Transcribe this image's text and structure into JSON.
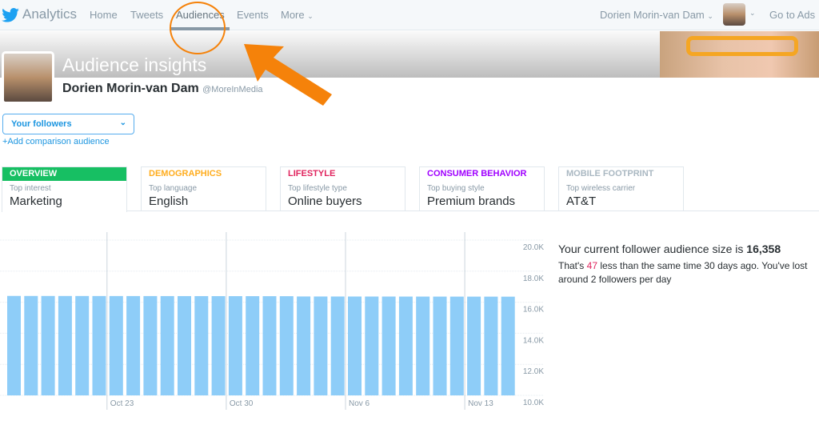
{
  "nav": {
    "brand": "Analytics",
    "items": [
      "Home",
      "Tweets",
      "Audiences",
      "Events",
      "More"
    ],
    "active": "Audiences",
    "user": "Dorien Morin-van Dam",
    "go_to_ads": "Go to Ads"
  },
  "header": {
    "title": "Audience insights",
    "name": "Dorien Morin-van Dam",
    "handle": "@MoreInMedia"
  },
  "audience_select": {
    "value": "Your followers",
    "add_link": "+Add comparison audience"
  },
  "tabs": [
    {
      "title": "OVERVIEW",
      "label": "Top interest",
      "value": "Marketing",
      "color": "#17bf63",
      "active": true
    },
    {
      "title": "DEMOGRAPHICS",
      "label": "Top language",
      "value": "English",
      "color": "#ffad1f"
    },
    {
      "title": "LIFESTYLE",
      "label": "Top lifestyle type",
      "value": "Online buyers",
      "color": "#e0245e"
    },
    {
      "title": "CONSUMER BEHAVIOR",
      "label": "Top buying style",
      "value": "Premium brands",
      "color": "#a000ff"
    },
    {
      "title": "MOBILE FOOTPRINT",
      "label": "Top wireless carrier",
      "value": "AT&T",
      "color": "#aab8c2"
    }
  ],
  "stats": {
    "headline": "Your current follower audience size is ",
    "size": "16,358",
    "pre": "That's ",
    "diff": "47",
    "post": " less than the same time 30 days ago. You've lost around 2 followers per day"
  },
  "chart_data": {
    "type": "bar",
    "ylim": [
      10000,
      20000
    ],
    "yticks": [
      "20.0K",
      "18.0K",
      "16.0K",
      "14.0K",
      "12.0K",
      "10.0K"
    ],
    "ytick_values": [
      20000,
      18000,
      16000,
      14000,
      12000,
      10000
    ],
    "xtick_labels": [
      "Oct 23",
      "Oct 30",
      "Nov 6",
      "Nov 13"
    ],
    "xtick_index": [
      6,
      13,
      20,
      27
    ],
    "bar_color": "#8ecdf8",
    "values": [
      16405,
      16403,
      16402,
      16401,
      16400,
      16399,
      16398,
      16397,
      16396,
      16395,
      16394,
      16393,
      16392,
      16391,
      16390,
      16389,
      16388,
      16370,
      16369,
      16368,
      16367,
      16366,
      16365,
      16364,
      16363,
      16362,
      16361,
      16360,
      16359,
      16358
    ]
  }
}
